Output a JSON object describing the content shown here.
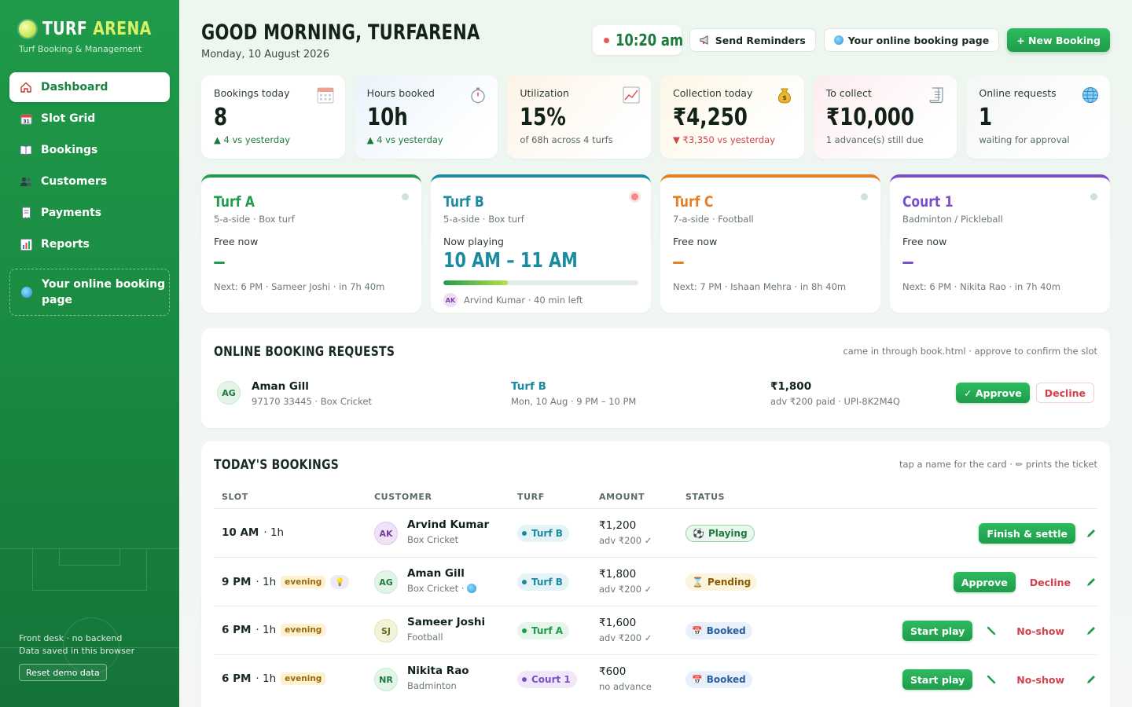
{
  "brand": {
    "name_part1": "TURF",
    "name_part2": "ARENA",
    "subtitle": "Turf Booking & Management"
  },
  "sidebar": {
    "items": [
      {
        "label": "Dashboard",
        "icon": "home-icon",
        "active": true
      },
      {
        "label": "Slot Grid",
        "icon": "calendar-icon"
      },
      {
        "label": "Bookings",
        "icon": "book-icon"
      },
      {
        "label": "Customers",
        "icon": "users-icon"
      },
      {
        "label": "Payments",
        "icon": "receipt-icon"
      },
      {
        "label": "Reports",
        "icon": "bar-chart-icon"
      }
    ],
    "online_link": "Your online booking page",
    "footer_line1": "Front desk · no backend",
    "footer_line2": "Data saved in this browser",
    "reset_label": "Reset demo data"
  },
  "header": {
    "greeting": "GOOD MORNING, TURFARENA",
    "date": "Monday, 10 August 2026",
    "clock": "10:20 am",
    "send_reminders": "Send Reminders",
    "online_booking_page": "Your online booking page",
    "new_booking": "+ New Booking"
  },
  "stats": [
    {
      "label": "Bookings today",
      "value": "8",
      "sub": "▲ 4 vs yesterday",
      "trend": "up",
      "icon": "calendar-icon"
    },
    {
      "label": "Hours booked",
      "value": "10h",
      "sub": "▲ 4 vs yesterday",
      "trend": "up",
      "icon": "stopwatch-icon"
    },
    {
      "label": "Utilization",
      "value": "15%",
      "sub": "of 68h across 4 turfs",
      "trend": "neutral",
      "icon": "trend-chart-icon"
    },
    {
      "label": "Collection today",
      "value": "₹4,250",
      "sub": "▼ ₹3,350 vs yesterday",
      "trend": "down",
      "icon": "money-bag-icon"
    },
    {
      "label": "To collect",
      "value": "₹10,000",
      "sub": "1 advance(s) still due",
      "trend": "neutral",
      "icon": "scroll-icon"
    },
    {
      "label": "Online requests",
      "value": "1",
      "sub": "waiting for approval",
      "trend": "neutral",
      "icon": "globe-icon"
    }
  ],
  "turfs": [
    {
      "name": "Turf A",
      "meta": "5-a-side · Box turf",
      "state": "Free now",
      "next": "Next: 6 PM · Sameer Joshi · in 7h 40m",
      "color": "#1f9c4b",
      "live": false
    },
    {
      "name": "Turf B",
      "meta": "5-a-side · Box turf",
      "state": "Now playing",
      "slot": "10 AM – 11 AM",
      "progress": 0.33,
      "player_initials": "AK",
      "player": "Arvind Kumar · 40 min left",
      "color": "#1b8ba0",
      "live": true
    },
    {
      "name": "Turf C",
      "meta": "7-a-side · Football",
      "state": "Free now",
      "next": "Next: 7 PM · Ishaan Mehra · in 8h 40m",
      "color": "#e67e22",
      "live": false
    },
    {
      "name": "Court 1",
      "meta": "Badminton / Pickleball",
      "state": "Free now",
      "next": "Next: 6 PM · Nikita Rao · in 7h 40m",
      "color": "#7b4fc9",
      "live": false
    }
  ],
  "requests": {
    "title": "ONLINE BOOKING REQUESTS",
    "hint": "came in through book.html · approve to confirm the slot",
    "items": [
      {
        "initials": "AG",
        "name": "Aman Gill",
        "sub": "97170 33445 · Box Cricket",
        "turf": "Turf B",
        "when": "Mon, 10 Aug · 9 PM – 10 PM",
        "amount": "₹1,800",
        "amount_sub": "adv ₹200 paid · UPI-8K2M4Q",
        "approve": "✓ Approve",
        "decline": "Decline"
      }
    ]
  },
  "bookings": {
    "title": "TODAY'S BOOKINGS",
    "hint": "tap a name for the card · ✏ prints the ticket",
    "columns": [
      "SLOT",
      "CUSTOMER",
      "TURF",
      "AMOUNT",
      "STATUS"
    ],
    "rows": [
      {
        "time": "10 AM",
        "dur": "· 1h",
        "tag": "",
        "initials": "AK",
        "avatar": "purple",
        "name": "Arvind Kumar",
        "sport": "Box Cricket",
        "turf": "Turf B",
        "turf_color": "#1b8ba0",
        "turf_bg": "#e4f4f6",
        "amount": "₹1,200",
        "amount_sub": "adv ₹200 ✓",
        "status": "Playing",
        "status_class": "playing",
        "status_icon": "⚽",
        "primary": "Finish & settle",
        "secondary": ""
      },
      {
        "time": "9 PM",
        "dur": "· 1h",
        "tag": "evening",
        "bulb": true,
        "initials": "AG",
        "avatar": "green",
        "name": "Aman Gill",
        "sport": "Box Cricket ·",
        "online": true,
        "turf": "Turf B",
        "turf_color": "#1b8ba0",
        "turf_bg": "#e4f4f6",
        "amount": "₹1,800",
        "amount_sub": "adv ₹200 ✓",
        "status": "Pending",
        "status_class": "pending",
        "status_icon": "⌛",
        "primary": "Approve",
        "secondary": "Decline"
      },
      {
        "time": "6 PM",
        "dur": "· 1h",
        "tag": "evening",
        "initials": "SJ",
        "avatar": "olive",
        "name": "Sameer Joshi",
        "sport": "Football",
        "turf": "Turf A",
        "turf_color": "#1f9c4b",
        "turf_bg": "#e6f5ea",
        "amount": "₹1,600",
        "amount_sub": "adv ₹200 ✓",
        "status": "Booked",
        "status_class": "booked",
        "status_icon": "📅",
        "primary": "Start play",
        "secondary": "No-show",
        "brush": true
      },
      {
        "time": "6 PM",
        "dur": "· 1h",
        "tag": "evening",
        "initials": "NR",
        "avatar": "green",
        "name": "Nikita Rao",
        "sport": "Badminton",
        "turf": "Court 1",
        "turf_color": "#7b4fc9",
        "turf_bg": "#efe8fa",
        "amount": "₹600",
        "amount_sub": "no advance",
        "status": "Booked",
        "status_class": "booked",
        "status_icon": "📅",
        "primary": "Start play",
        "secondary": "No-show",
        "brush": true
      }
    ]
  }
}
